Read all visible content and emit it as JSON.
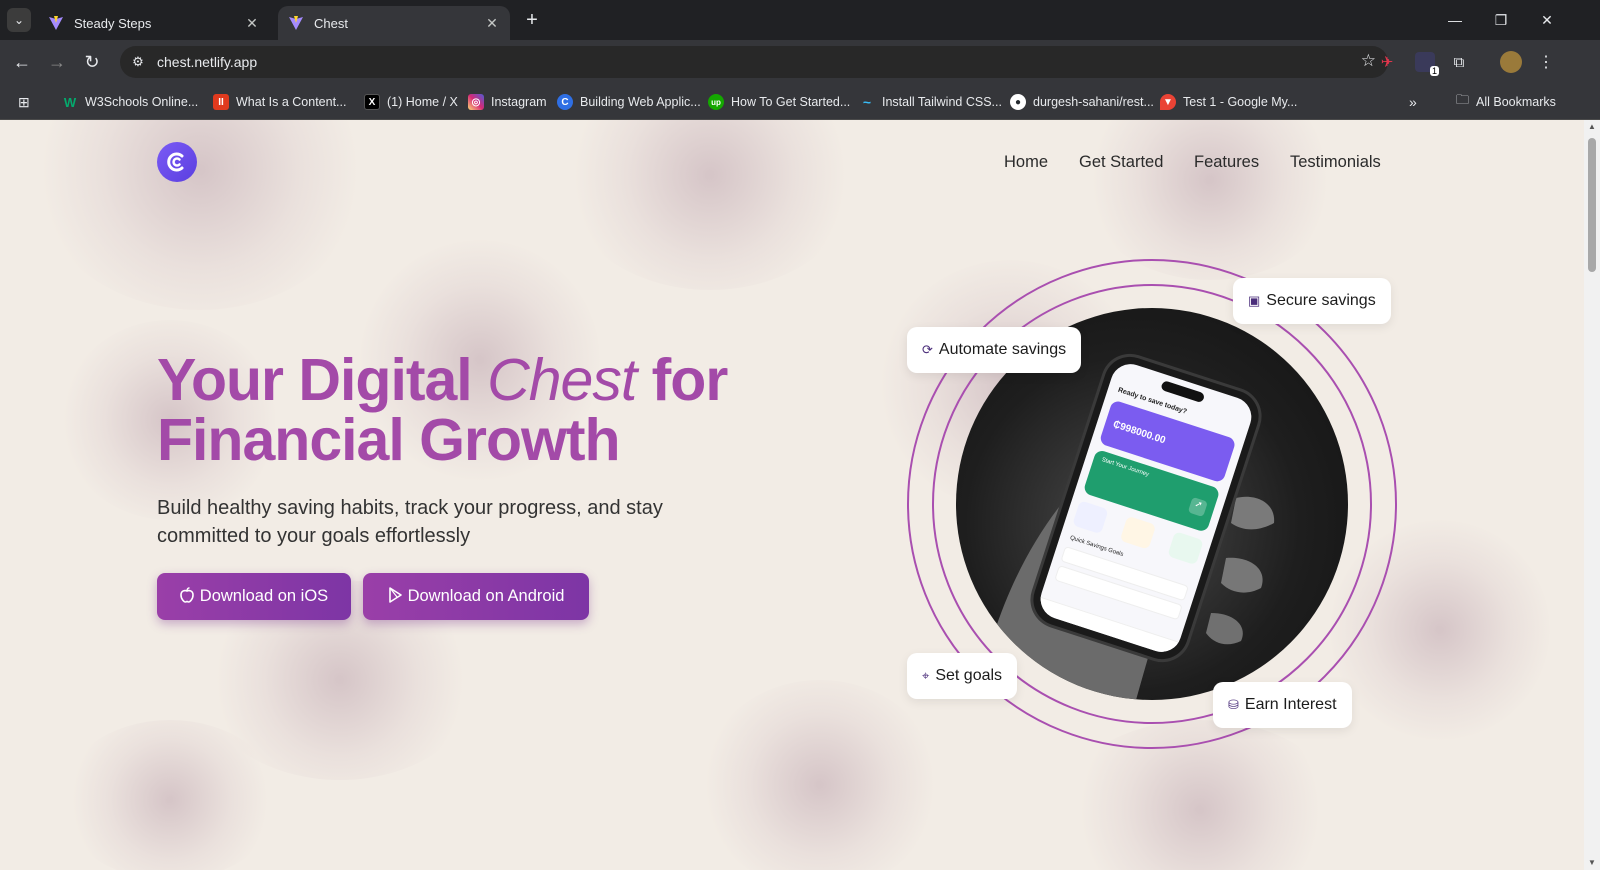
{
  "browser": {
    "tabs": [
      {
        "title": "Steady Steps",
        "active": false
      },
      {
        "title": "Chest",
        "active": true
      }
    ],
    "url": "chest.netlify.app",
    "bookmarks": [
      {
        "label": "W3Schools Online...",
        "icon_color": "#04aa6d",
        "icon_text": "W"
      },
      {
        "label": "What Is a Content...",
        "icon_color": "#e03a1e",
        "icon_text": "II"
      },
      {
        "label": "(1) Home / X",
        "icon_color": "#000000",
        "icon_text": "X"
      },
      {
        "label": "Instagram",
        "icon_color": "#d62976",
        "icon_text": "◎"
      },
      {
        "label": "Building Web Applic...",
        "icon_color": "#2f6fe4",
        "icon_text": "C"
      },
      {
        "label": "How To Get Started...",
        "icon_color": "#14a800",
        "icon_text": "up"
      },
      {
        "label": "Install Tailwind CSS...",
        "icon_color": "#38bdf8",
        "icon_text": "~"
      },
      {
        "label": "durgesh-sahani/rest...",
        "icon_color": "#24292f",
        "icon_text": "●"
      },
      {
        "label": "Test 1 - Google My...",
        "icon_color": "#ea4335",
        "icon_text": "▼"
      }
    ],
    "all_bookmarks_label": "All Bookmarks",
    "extension_badge": "1"
  },
  "page": {
    "nav": {
      "items": [
        "Home",
        "Get Started",
        "Features",
        "Testimonials"
      ]
    },
    "hero": {
      "title_part1": "Your Digital ",
      "title_italic": "Chest",
      "title_part2": " for",
      "title_line2": "Financial Growth",
      "subtitle": "Build healthy saving habits, track your progress, and stay committed to your goals effortlessly",
      "ios_button": "Download on iOS",
      "android_button": "Download on Android"
    },
    "feature_pills": {
      "secure": "Secure savings",
      "automate": "Automate savings",
      "goals": "Set goals",
      "interest": "Earn Interest"
    },
    "phone_screen": {
      "greeting": "Ready to save today?",
      "balance": "₵998000.00",
      "journey": "Start Your Journey",
      "quick_goals": "Quick Savings Goals"
    }
  },
  "colors": {
    "brand_purple": "#a34aa8",
    "logo": "#6a4cf0",
    "background": "#f2ece5"
  }
}
